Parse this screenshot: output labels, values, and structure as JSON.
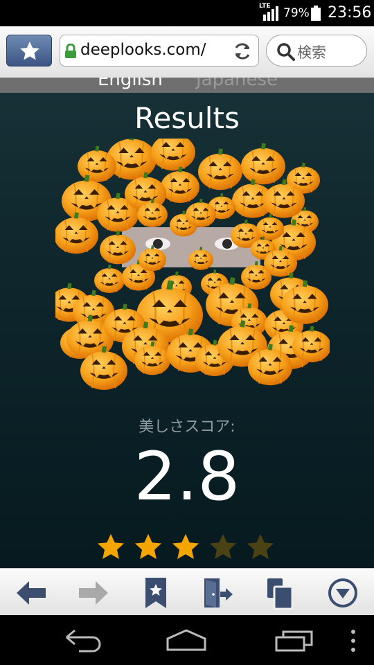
{
  "status": {
    "network": "LTE",
    "battery": "79%",
    "time": "23:56"
  },
  "browser": {
    "url": "deeplooks.com/",
    "search_placeholder": "検索"
  },
  "page": {
    "languages": [
      "English",
      "Japanese"
    ],
    "title": "Results",
    "score_label": "美しさスコア:",
    "score": "2.8",
    "rating": {
      "filled": 3,
      "total": 5
    }
  },
  "colors": {
    "star_on": "#f5a500",
    "star_off": "#4a4115",
    "toolbar_icon": "#3c4e70",
    "pumpkin": "#f7a21c"
  },
  "icons": [
    "bookmark-star-icon",
    "lock-icon",
    "reload-icon",
    "search-icon",
    "back-arrow-icon",
    "forward-arrow-icon",
    "bookmarks-icon",
    "exit-icon",
    "tabs-icon",
    "menu-down-icon",
    "nav-back-icon",
    "nav-home-icon",
    "nav-recents-icon",
    "nav-overflow-icon"
  ]
}
